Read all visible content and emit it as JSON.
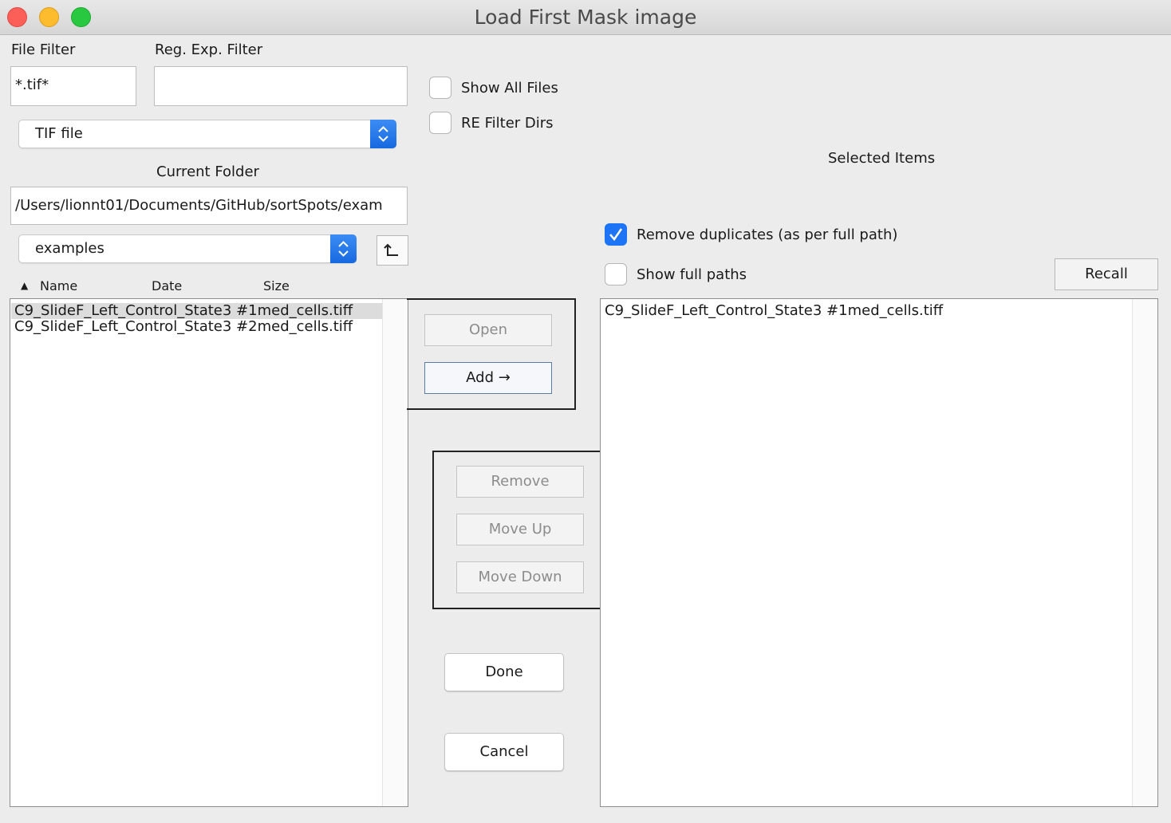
{
  "window": {
    "title": "Load First Mask image"
  },
  "filters": {
    "file_filter_label": "File Filter",
    "file_filter_value": "*.tif*",
    "regex_filter_label": "Reg. Exp. Filter",
    "regex_filter_value": "",
    "type_select_value": "TIF file",
    "show_all_files_label": "Show All Files",
    "show_all_files_checked": false,
    "re_filter_dirs_label": "RE Filter Dirs",
    "re_filter_dirs_checked": false
  },
  "folder": {
    "label": "Current Folder",
    "path": "/Users/lionnt01/Documents/GitHub/sortSpots/exam",
    "select_value": "examples"
  },
  "file_list": {
    "columns": [
      "Name",
      "Date",
      "Size"
    ],
    "sort_indicator": "▲",
    "items": [
      {
        "name": "C9_SlideF_Left_Control_State3 #1med_cells.tiff",
        "selected": true
      },
      {
        "name": "C9_SlideF_Left_Control_State3 #2med_cells.tiff",
        "selected": false
      }
    ]
  },
  "actions": {
    "open": "Open",
    "add": "Add",
    "add_arrow": "→",
    "remove": "Remove",
    "move_up": "Move Up",
    "move_down": "Move Down",
    "done": "Done",
    "cancel": "Cancel"
  },
  "selected": {
    "title": "Selected Items",
    "remove_duplicates_label": "Remove duplicates (as per full path)",
    "remove_duplicates_checked": true,
    "show_full_paths_label": "Show full paths",
    "show_full_paths_checked": false,
    "recall": "Recall",
    "items": [
      "C9_SlideF_Left_Control_State3 #1med_cells.tiff"
    ]
  },
  "colors": {
    "accent": "#1d74f5",
    "window_bg": "#ececec"
  }
}
